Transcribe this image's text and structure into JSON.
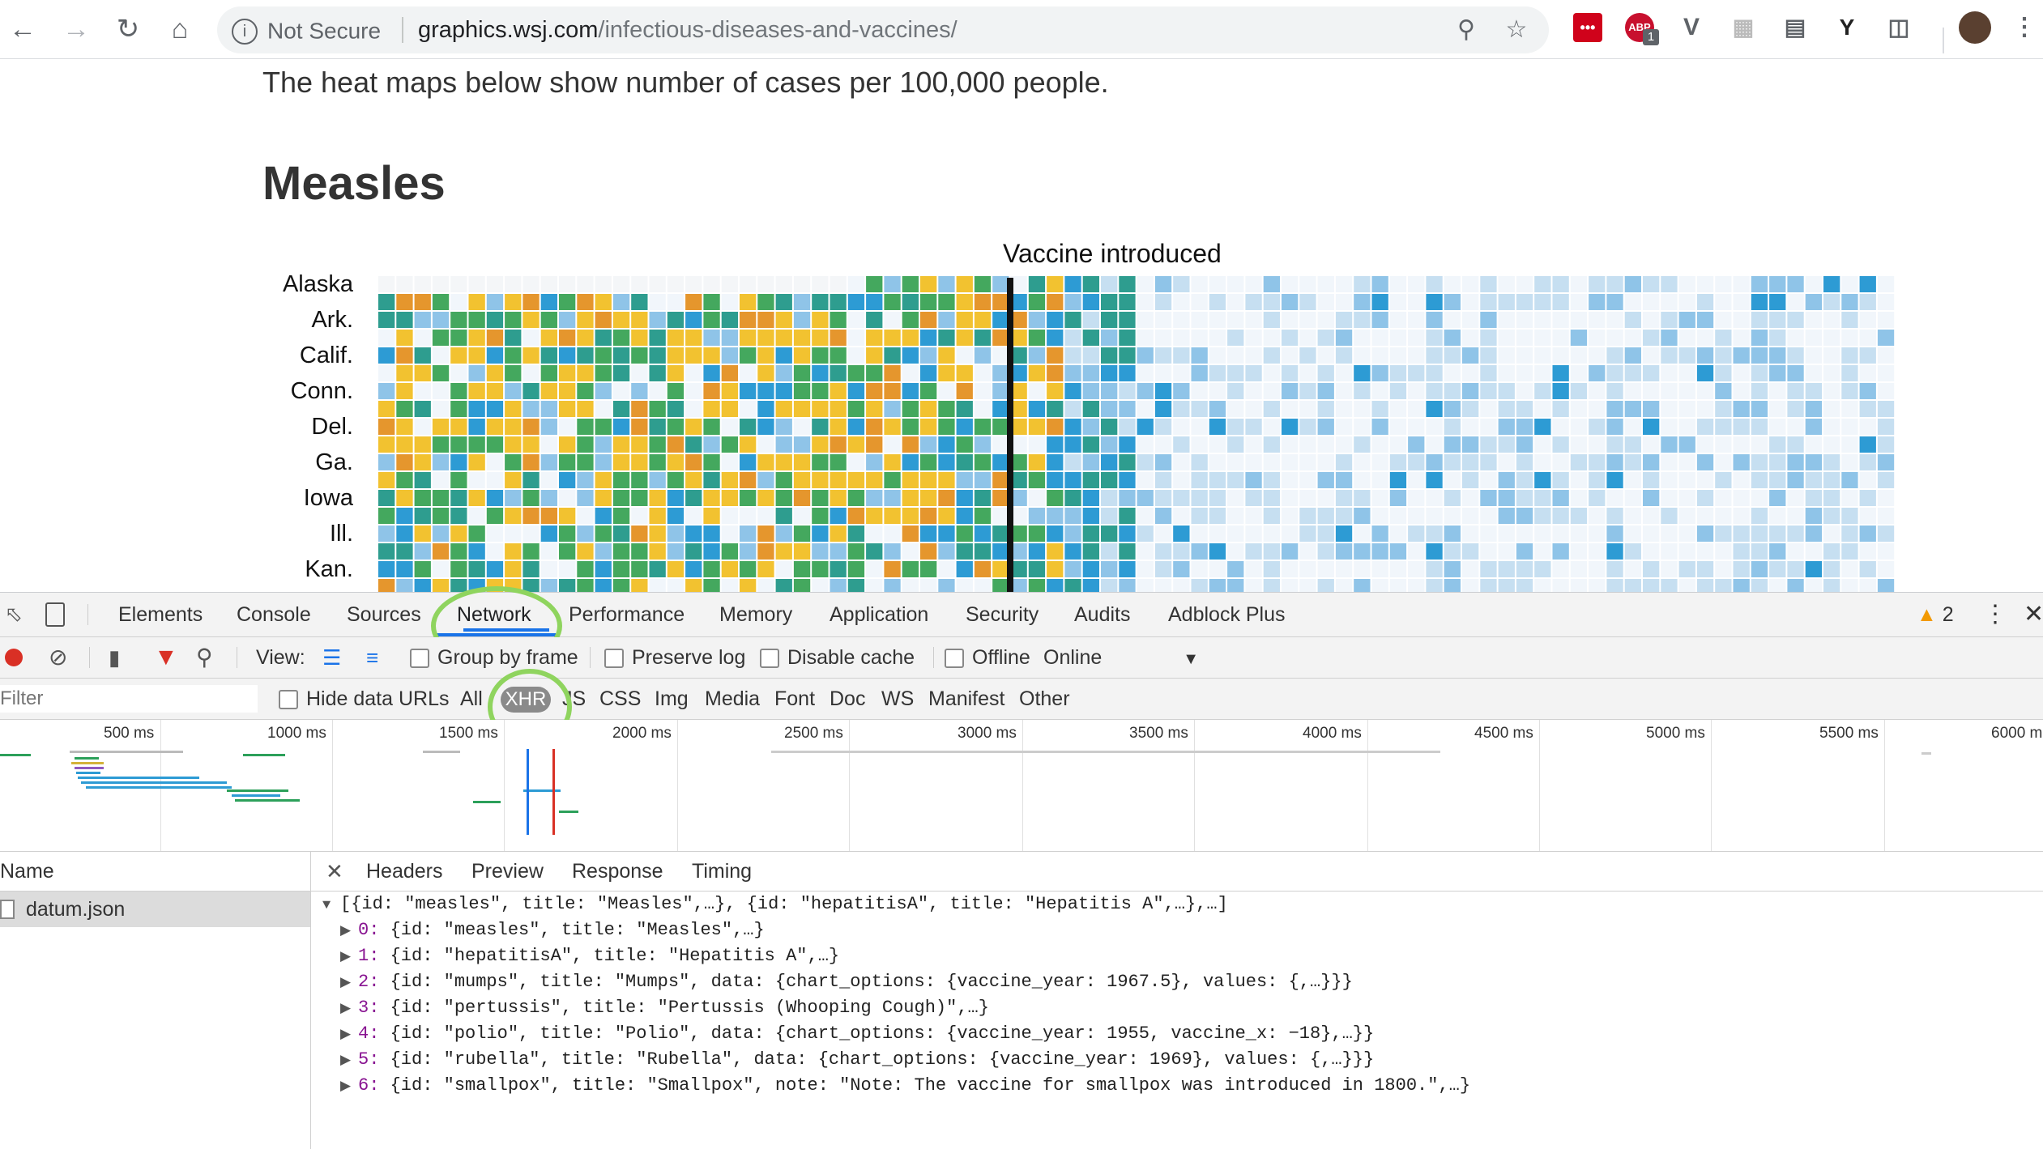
{
  "browser": {
    "security_label": "Not Secure",
    "url_host": "graphics.wsj.com",
    "url_path": "/infectious-diseases-and-vaccines/",
    "extension_badge": "1",
    "icons": [
      "back-arrow-icon",
      "forward-arrow-icon",
      "reload-icon",
      "home-icon",
      "info-icon",
      "zoom-icon",
      "star-icon",
      "lastpass-icon",
      "adblock-icon",
      "vimium-icon",
      "grid-icon",
      "reader-icon",
      "y-icon",
      "bookmark-icon",
      "avatar",
      "menu-icon"
    ]
  },
  "page": {
    "intro": "The heat maps below show number of cases per 100,000 people.",
    "title": "Measles",
    "vaccine_label": "Vaccine introduced",
    "states": [
      "Alaska",
      "Ark.",
      "Calif.",
      "Conn.",
      "Del.",
      "Ga.",
      "Iowa",
      "Ill.",
      "Kan."
    ],
    "heatmap_colors": {
      "very_low": "#f1f6fb",
      "low": "#c6dff1",
      "mid_low": "#8fc4e8",
      "mid": "#2d9bd4",
      "mid_high": "#2e9d8f",
      "high": "#44a85e",
      "very_high": "#f2c230",
      "peak": "#e5962d"
    }
  },
  "devtools": {
    "tabs": [
      "Elements",
      "Console",
      "Sources",
      "Network",
      "Performance",
      "Memory",
      "Application",
      "Security",
      "Audits",
      "Adblock Plus"
    ],
    "warning_count": "2",
    "toolbar": {
      "view_label": "View:",
      "group_by_frame": "Group by frame",
      "preserve_log": "Preserve log",
      "disable_cache": "Disable cache",
      "offline": "Offline",
      "throttle": "Online"
    },
    "filter": {
      "placeholder": "Filter",
      "hide_data_urls": "Hide data URLs",
      "types": [
        "All",
        "XHR",
        "JS",
        "CSS",
        "Img",
        "Media",
        "Font",
        "Doc",
        "WS",
        "Manifest",
        "Other"
      ]
    },
    "timeline_ticks": [
      "500 ms",
      "1000 ms",
      "1500 ms",
      "2000 ms",
      "2500 ms",
      "3000 ms",
      "3500 ms",
      "4000 ms",
      "4500 ms",
      "5000 ms",
      "5500 ms",
      "6000 m"
    ],
    "name_header": "Name",
    "requests": [
      "datum.json"
    ],
    "detail_tabs": [
      "Headers",
      "Preview",
      "Response",
      "Timing"
    ],
    "preview": {
      "root": "[{id: \"measles\", title: \"Measles\",…}, {id: \"hepatitisA\", title: \"Hepatitis A\",…},…]",
      "items": [
        {
          "index": "0:",
          "text": " {id: \"measles\", title: \"Measles\",…}"
        },
        {
          "index": "1:",
          "text": " {id: \"hepatitisA\", title: \"Hepatitis A\",…}"
        },
        {
          "index": "2:",
          "text": " {id: \"mumps\", title: \"Mumps\", data: {chart_options: {vaccine_year: 1967.5}, values: {,…}}}"
        },
        {
          "index": "3:",
          "text": " {id: \"pertussis\", title: \"Pertussis (Whooping Cough)\",…}"
        },
        {
          "index": "4:",
          "text": " {id: \"polio\", title: \"Polio\", data: {chart_options: {vaccine_year: 1955, vaccine_x: −18},…}}"
        },
        {
          "index": "5:",
          "text": " {id: \"rubella\", title: \"Rubella\", data: {chart_options: {vaccine_year: 1969}, values: {,…}}}"
        },
        {
          "index": "6:",
          "text": " {id: \"smallpox\", title: \"Smallpox\", note: \"Note: The vaccine for smallpox was introduced in 1800.\",…}"
        }
      ]
    }
  }
}
